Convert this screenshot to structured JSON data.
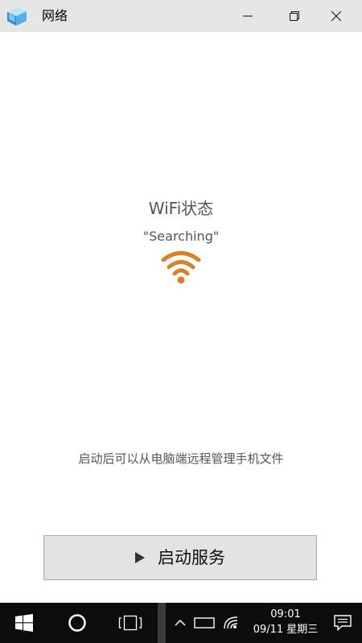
{
  "window": {
    "title": "网络",
    "icon": "network-app-icon",
    "controls": [
      "minimize-icon",
      "restore-icon",
      "close-icon"
    ]
  },
  "main": {
    "wifi_title": "WiFi状态",
    "wifi_status": "\"Searching\"",
    "wifi_icon": "wifi-icon",
    "wifi_icon_color": "#d9812a",
    "hint": "启动后可以从电脑端远程管理手机文件",
    "start_button": {
      "label": "启动服务",
      "icon": "play-icon"
    }
  },
  "taskbar": {
    "icons": [
      "windows-start-icon",
      "cortana-icon",
      "task-view-icon",
      "chevron-up-icon",
      "tablet-mode-icon",
      "wifi-tray-icon",
      "action-center-icon"
    ],
    "time": "09:01",
    "date": "09/11 星期三"
  }
}
